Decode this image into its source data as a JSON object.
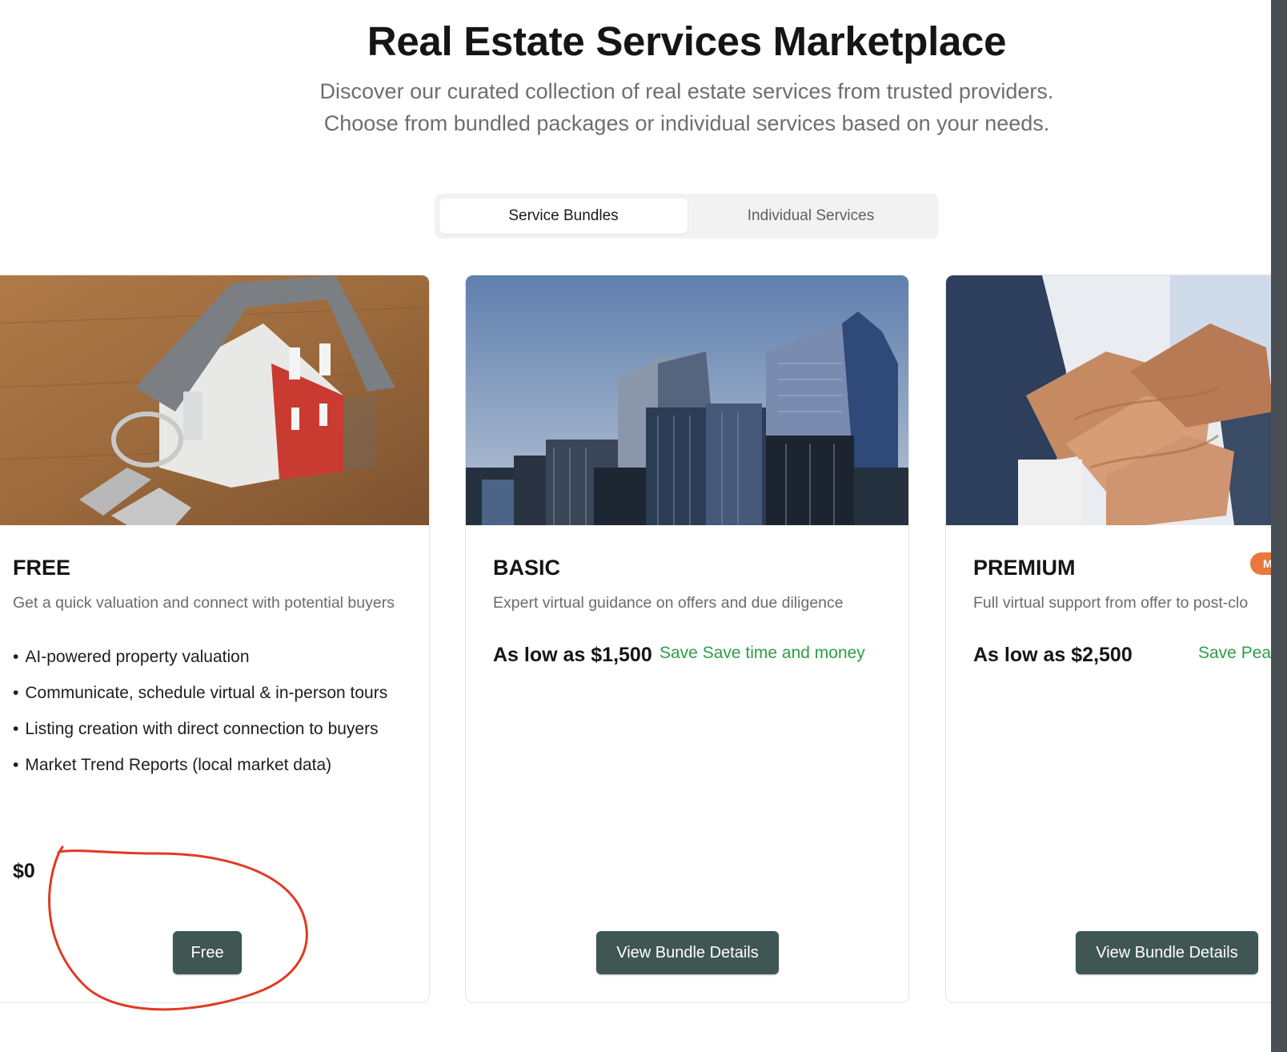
{
  "header": {
    "title": "Real Estate Services Marketplace",
    "subtitle_line1": "Discover our curated collection of real estate services from trusted providers.",
    "subtitle_line2": "Choose from bundled packages or individual services based on your needs."
  },
  "tabs": [
    {
      "label": "Service Bundles",
      "active": true
    },
    {
      "label": "Individual Services",
      "active": false
    }
  ],
  "bundles": [
    {
      "name": "FREE",
      "image": "house-model-with-keys",
      "description": "Get a quick valuation and connect with potential buyers",
      "features": [
        "AI-powered property valuation",
        "Communicate, schedule virtual & in-person tours",
        "Listing creation with direct connection to buyers",
        "Market Trend Reports (local market data)"
      ],
      "price": "$0",
      "button": "Free"
    },
    {
      "name": "BASIC",
      "image": "city-skyscrapers",
      "description": "Expert virtual guidance on offers and due diligence",
      "price": "As low as $1,500",
      "save": "Save Save time and money",
      "button": "View Bundle Details"
    },
    {
      "name": "PREMIUM",
      "image": "business-hands-stacked",
      "badge": "M",
      "description": "Full virtual support from offer to post-clo",
      "price": "As low as $2,500",
      "save": "Save Pea",
      "button": "View Bundle Details"
    }
  ],
  "colors": {
    "button_bg": "#3f5653",
    "save_text": "#2e9e45",
    "badge": "#e8793a",
    "annotation": "#e03a22"
  },
  "bullet": "•"
}
